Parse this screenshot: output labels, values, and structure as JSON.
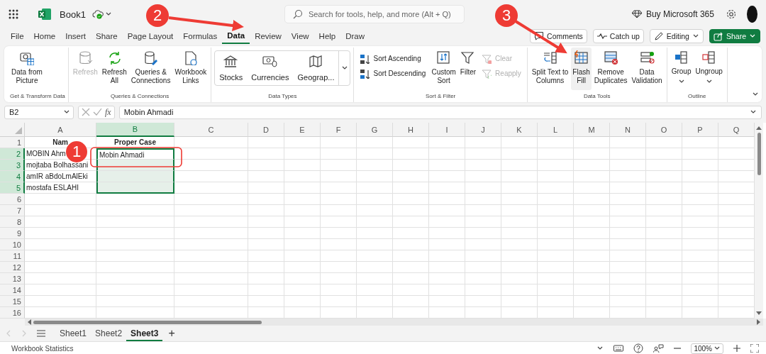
{
  "title_bar": {
    "title": "Book1",
    "search_placeholder": "Search for tools, help, and more (Alt + Q)",
    "buy_label": "Buy Microsoft 365"
  },
  "menu_tabs": [
    {
      "label": "File",
      "selected": false
    },
    {
      "label": "Home",
      "selected": false
    },
    {
      "label": "Insert",
      "selected": false
    },
    {
      "label": "Share",
      "selected": false
    },
    {
      "label": "Page Layout",
      "selected": false
    },
    {
      "label": "Formulas",
      "selected": false
    },
    {
      "label": "Data",
      "selected": true
    },
    {
      "label": "Review",
      "selected": false
    },
    {
      "label": "View",
      "selected": false
    },
    {
      "label": "Help",
      "selected": false
    },
    {
      "label": "Draw",
      "selected": false
    }
  ],
  "actions": [
    {
      "label": "Comments",
      "kind": "plain"
    },
    {
      "label": "Catch up",
      "kind": "plain"
    },
    {
      "label": "Editing",
      "kind": "menu"
    },
    {
      "label": "Share",
      "kind": "primary"
    }
  ],
  "ribbon": {
    "groups": [
      {
        "label": "Get & Transform Data",
        "items": [
          {
            "kind": "large",
            "label": "Data from\nPicture",
            "disabled": false,
            "hovered": false
          }
        ]
      },
      {
        "label": "Queries & Connections",
        "items": [
          {
            "kind": "large",
            "label": "Refresh",
            "disabled": true,
            "hovered": false
          },
          {
            "kind": "large",
            "label": "Refresh\nAll",
            "disabled": false,
            "hovered": false
          },
          {
            "kind": "large",
            "label": "Queries &\nConnections",
            "disabled": false,
            "hovered": false
          },
          {
            "kind": "large",
            "label": "Workbook\nLinks",
            "disabled": false,
            "hovered": false
          }
        ]
      },
      {
        "label": "Data Types",
        "items": [
          {
            "kind": "gallery",
            "label": "Stocks",
            "disabled": false,
            "hovered": false
          },
          {
            "kind": "gallery",
            "label": "Currencies",
            "disabled": false,
            "hovered": false
          },
          {
            "kind": "gallery",
            "label": "Geograp...",
            "disabled": false,
            "hovered": false
          }
        ]
      },
      {
        "label": "Sort & Filter",
        "items": [
          {
            "kind": "small",
            "label": "Sort Ascending",
            "disabled": false,
            "hovered": false
          },
          {
            "kind": "small",
            "label": "Sort Descending",
            "disabled": false,
            "hovered": false
          },
          {
            "kind": "large",
            "label": "Custom\nSort",
            "disabled": false,
            "hovered": false
          },
          {
            "kind": "large",
            "label": "Filter",
            "disabled": false,
            "hovered": false
          },
          {
            "kind": "small",
            "label": "Clear",
            "disabled": true,
            "hovered": false
          },
          {
            "kind": "small",
            "label": "Reapply",
            "disabled": true,
            "hovered": false
          }
        ]
      },
      {
        "label": "Data Tools",
        "items": [
          {
            "kind": "large",
            "label": "Split Text to\nColumns",
            "disabled": false,
            "hovered": false
          },
          {
            "kind": "large",
            "label": "Flash\nFill",
            "disabled": false,
            "hovered": true
          },
          {
            "kind": "large",
            "label": "Remove\nDuplicates",
            "disabled": false,
            "hovered": false
          },
          {
            "kind": "large",
            "label": "Data\nValidation",
            "disabled": false,
            "hovered": false
          }
        ]
      },
      {
        "label": "Outline",
        "items": [
          {
            "kind": "menu",
            "label": "Group",
            "disabled": false,
            "hovered": false
          },
          {
            "kind": "menu",
            "label": "Ungroup",
            "disabled": false,
            "hovered": false
          }
        ]
      }
    ]
  },
  "formula_bar": {
    "name_box": "B2",
    "function_label": "fx",
    "value": "Mobin Ahmadi"
  },
  "sheet": {
    "columns": [
      {
        "label": "A",
        "selected": false
      },
      {
        "label": "B",
        "selected": true
      },
      {
        "label": "C",
        "selected": false
      },
      {
        "label": "D",
        "selected": false
      },
      {
        "label": "E",
        "selected": false
      },
      {
        "label": "F",
        "selected": false
      },
      {
        "label": "G",
        "selected": false
      },
      {
        "label": "H",
        "selected": false
      },
      {
        "label": "I",
        "selected": false
      },
      {
        "label": "J",
        "selected": false
      },
      {
        "label": "K",
        "selected": false
      },
      {
        "label": "L",
        "selected": false
      },
      {
        "label": "M",
        "selected": false
      },
      {
        "label": "N",
        "selected": false
      },
      {
        "label": "O",
        "selected": false
      },
      {
        "label": "P",
        "selected": false
      },
      {
        "label": "Q",
        "selected": false
      }
    ],
    "rows": [
      {
        "label": "1",
        "selected": false,
        "kind": "header",
        "cells": [
          "Nam",
          "Proper Case"
        ]
      },
      {
        "label": "2",
        "selected": true,
        "kind": "data",
        "cells": [
          "MOBIN Ahm",
          "Mobin Ahmadi"
        ]
      },
      {
        "label": "3",
        "selected": true,
        "kind": "data",
        "cells": [
          "mojtaba Bolhassani"
        ]
      },
      {
        "label": "4",
        "selected": true,
        "kind": "data",
        "cells": [
          "amIR aBdoLmAlEki"
        ]
      },
      {
        "label": "5",
        "selected": true,
        "kind": "data",
        "cells": [
          "mostafa ESLAHI"
        ]
      },
      {
        "label": "6",
        "selected": false,
        "kind": "data"
      },
      {
        "label": "7",
        "selected": false,
        "kind": "data"
      },
      {
        "label": "8",
        "selected": false,
        "kind": "data"
      },
      {
        "label": "9",
        "selected": false,
        "kind": "data"
      },
      {
        "label": "10",
        "selected": false,
        "kind": "data"
      },
      {
        "label": "11",
        "selected": false,
        "kind": "data"
      },
      {
        "label": "12",
        "selected": false,
        "kind": "data"
      },
      {
        "label": "13",
        "selected": false,
        "kind": "data"
      },
      {
        "label": "14",
        "selected": false,
        "kind": "data"
      },
      {
        "label": "15",
        "selected": false,
        "kind": "data"
      },
      {
        "label": "16",
        "selected": false,
        "kind": "data"
      }
    ]
  },
  "sheet_tabs": [
    {
      "label": "Sheet1",
      "selected": false
    },
    {
      "label": "Sheet2",
      "selected": false
    },
    {
      "label": "Sheet3",
      "selected": true
    }
  ],
  "add_sheet": "+",
  "status_bar": {
    "label": "Workbook Statistics",
    "zoom": "100%"
  },
  "callouts": [
    {
      "label": "1",
      "kind": "box"
    },
    {
      "label": "2",
      "kind": "arrow"
    },
    {
      "label": "3",
      "kind": "arrow"
    }
  ]
}
